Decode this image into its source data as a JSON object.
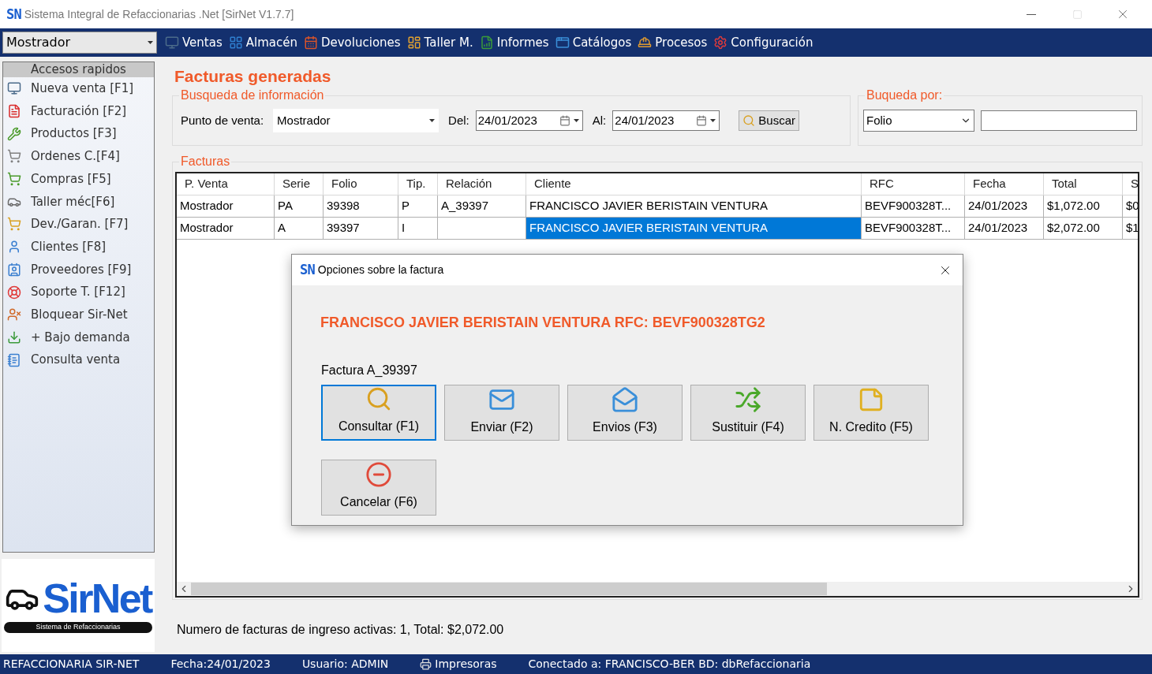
{
  "window": {
    "logo": "SN",
    "title": "Sistema Integral de Refaccionarias .Net [SirNet V1.7.7]"
  },
  "menu_bar": {
    "point_of_sale": "Mostrador",
    "items": [
      {
        "label": "Ventas"
      },
      {
        "label": "Almacén"
      },
      {
        "label": "Devoluciones"
      },
      {
        "label": "Taller M."
      },
      {
        "label": "Informes"
      },
      {
        "label": "Catálogos"
      },
      {
        "label": "Procesos"
      },
      {
        "label": "Configuración"
      }
    ]
  },
  "sidebar": {
    "header": "Accesos rapidos",
    "items": [
      {
        "label": "Nueva venta [F1]"
      },
      {
        "label": "Facturación [F2]"
      },
      {
        "label": "Productos [F3]"
      },
      {
        "label": "Ordenes C.[F4]"
      },
      {
        "label": "Compras [F5]"
      },
      {
        "label": "Taller méc[F6]"
      },
      {
        "label": "Dev./Garan. [F7]"
      },
      {
        "label": "Clientes [F8]"
      },
      {
        "label": "Proveedores [F9]"
      },
      {
        "label": "Soporte T. [F12]"
      },
      {
        "label": "Bloquear Sir-Net"
      },
      {
        "label": "+ Bajo demanda"
      },
      {
        "label": "Consulta venta"
      }
    ],
    "logo": {
      "name": "SirNet",
      "tagline": "Sistema de Refaccionarias"
    }
  },
  "page_title": "Facturas generadas",
  "search": {
    "title": "Busqueda de información",
    "point_label": "Punto de venta:",
    "point_value": "Mostrador",
    "from_label": "Del:",
    "from_value": "24/01/2023",
    "to_label": "Al:",
    "to_value": "24/01/2023",
    "button": "Buscar"
  },
  "search_by": {
    "title": "Buqueda por:",
    "field": "Folio"
  },
  "invoices": {
    "title": "Facturas",
    "columns": [
      "P. Venta",
      "Serie",
      "Folio",
      "Tip.",
      "Relación",
      "Cliente",
      "RFC",
      "Fecha",
      "Total",
      "S"
    ],
    "rows": [
      {
        "cells": [
          {
            "text": "Mostrador",
            "selected": false
          },
          {
            "text": "PA",
            "selected": false
          },
          {
            "text": "39398",
            "selected": false
          },
          {
            "text": "P",
            "selected": false
          },
          {
            "text": "A_39397",
            "selected": false
          },
          {
            "text": "FRANCISCO JAVIER BERISTAIN VENTURA",
            "selected": false
          },
          {
            "text": "BEVF900328T...",
            "selected": false
          },
          {
            "text": "24/01/2023",
            "selected": false
          },
          {
            "text": "$1,072.00",
            "selected": false
          },
          {
            "text": "$0",
            "selected": false
          }
        ]
      },
      {
        "cells": [
          {
            "text": "Mostrador",
            "selected": false
          },
          {
            "text": "A",
            "selected": false
          },
          {
            "text": "39397",
            "selected": false
          },
          {
            "text": "I",
            "selected": false
          },
          {
            "text": "",
            "selected": false
          },
          {
            "text": "FRANCISCO JAVIER BERISTAIN VENTURA",
            "selected": true
          },
          {
            "text": "BEVF900328T...",
            "selected": false
          },
          {
            "text": "24/01/2023",
            "selected": false
          },
          {
            "text": "$2,072.00",
            "selected": false
          },
          {
            "text": "$1",
            "selected": false
          }
        ]
      }
    ]
  },
  "summary": "Numero de facturas de ingreso activas: 1, Total: $2,072.00",
  "dialog": {
    "logo": "SN",
    "title": "Opciones sobre la factura",
    "heading": "FRANCISCO JAVIER BERISTAIN VENTURA RFC: BEVF900328TG2",
    "invoice_label": "Factura A_39397",
    "buttons": [
      {
        "label": "Consultar (F1)",
        "focused": true
      },
      {
        "label": "Enviar (F2)",
        "focused": false
      },
      {
        "label": "Envios (F3)",
        "focused": false
      },
      {
        "label": "Sustituir (F4)",
        "focused": false
      },
      {
        "label": "N. Credito (F5)",
        "focused": false
      },
      {
        "label": "Cancelar (F6)",
        "focused": false
      }
    ]
  },
  "status_bar": [
    {
      "text": "REFACCIONARIA SIR-NET",
      "kind": "text"
    },
    {
      "text": "Fecha:24/01/2023",
      "kind": "text"
    },
    {
      "text": "Usuario: ADMIN",
      "kind": "text"
    },
    {
      "text": "Impresoras",
      "kind": "printer"
    },
    {
      "text": "Conectado a: FRANCISCO-BER BD: dbRefaccionaria",
      "kind": "text"
    }
  ]
}
